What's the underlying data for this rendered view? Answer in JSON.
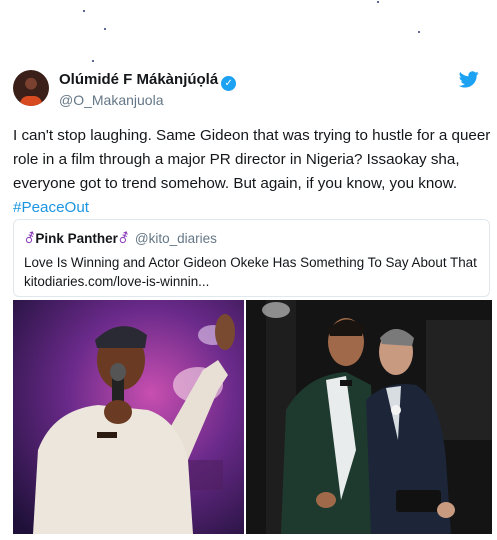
{
  "tweet": {
    "author_name": "Olúmidé F Mákànjúọlá",
    "author_handle": "@O_Makanjuola",
    "verified_icon": "verified-badge-icon",
    "platform_icon": "twitter-bird-icon",
    "text": "I can't stop laughing. Same Gideon that was trying to hustle for a queer role in a film through a major PR director in Nigeria? Issaokay sha, everyone got to trend somehow. But again, if you know, you know.",
    "hashtag": "#PeaceOut"
  },
  "quoted_tweet": {
    "author_name": "Pink Panther",
    "author_symbol": "⚦",
    "author_handle": "@kito_diaries",
    "text": "Love Is Winning and Actor Gideon Okeke Has Something To Say About That kitodiaries.com/love-is-winnin..."
  },
  "media": {
    "left_image": "man-speaking-into-microphone-photo",
    "right_image": "two-men-in-suits-kissing-photo"
  },
  "colors": {
    "link": "#1b95e0",
    "verified": "#1da1f2",
    "secondary_text": "#657786",
    "border": "#e1e8ed"
  }
}
